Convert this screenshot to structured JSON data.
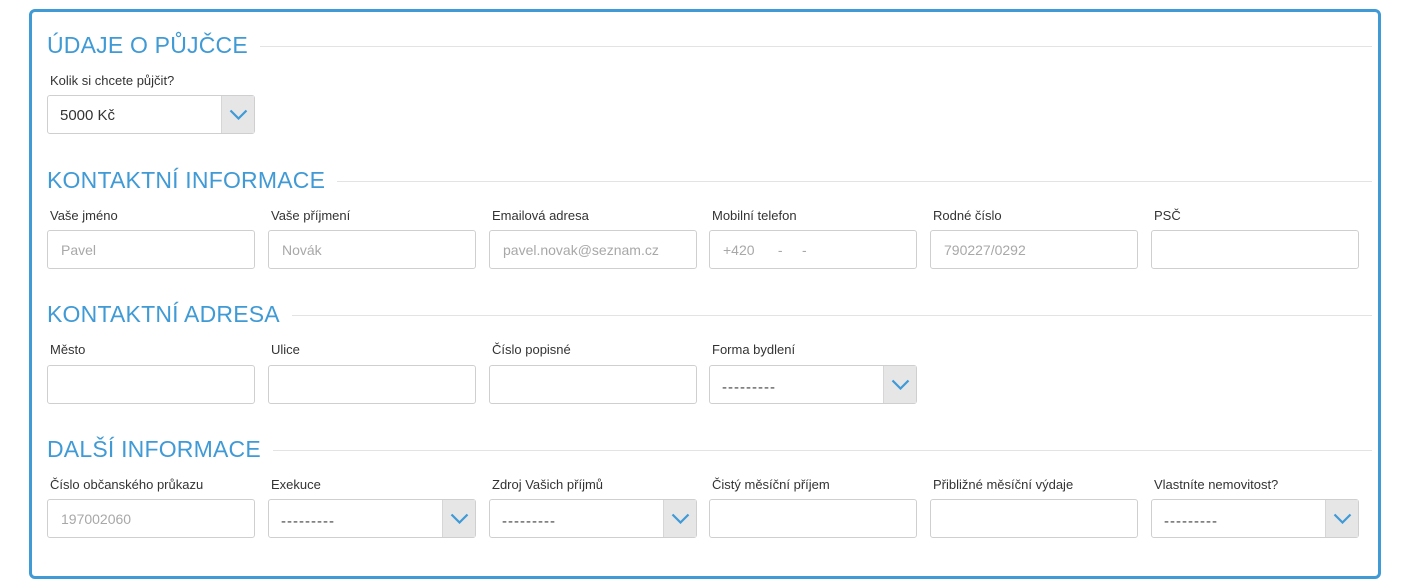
{
  "loan": {
    "title": "ÚDAJE O PŮJČCE",
    "amount_label": "Kolik si chcete půjčit?",
    "amount_value": "5000 Kč"
  },
  "contact": {
    "title": "KONTAKTNÍ INFORMACE",
    "first_name": {
      "label": "Vaše jméno",
      "placeholder": "Pavel"
    },
    "last_name": {
      "label": "Vaše příjmení",
      "placeholder": "Novák"
    },
    "email": {
      "label": "Emailová adresa",
      "placeholder": "pavel.novak@seznam.cz"
    },
    "phone": {
      "label": "Mobilní telefon",
      "placeholder": "+420      -     -"
    },
    "birth_number": {
      "label": "Rodné číslo",
      "placeholder": "790227/0292"
    },
    "zip": {
      "label": "PSČ",
      "placeholder": ""
    }
  },
  "address": {
    "title": "KONTAKTNÍ ADRESA",
    "city": {
      "label": "Město",
      "placeholder": ""
    },
    "street": {
      "label": "Ulice",
      "placeholder": ""
    },
    "house_number": {
      "label": "Číslo popisné",
      "placeholder": ""
    },
    "housing": {
      "label": "Forma bydlení",
      "value": "---------"
    }
  },
  "more": {
    "title": "DALŠÍ INFORMACE",
    "id_card": {
      "label": "Číslo občanského průkazu",
      "placeholder": "197002060"
    },
    "execution": {
      "label": "Exekuce",
      "value": "---------"
    },
    "income_source": {
      "label": "Zdroj Vašich příjmů",
      "value": "---------"
    },
    "net_income": {
      "label": "Čistý měsíční příjem",
      "placeholder": ""
    },
    "expenses": {
      "label": "Přibližné měsíční výdaje",
      "placeholder": ""
    },
    "property": {
      "label": "Vlastníte nemovitost?",
      "value": "---------"
    }
  },
  "colors": {
    "accent": "#3f9ad6",
    "arrow": "#3f9ad6",
    "arrow_bg": "#e6e6e6"
  },
  "icons": {
    "dropdown": "chevron-down-icon"
  }
}
